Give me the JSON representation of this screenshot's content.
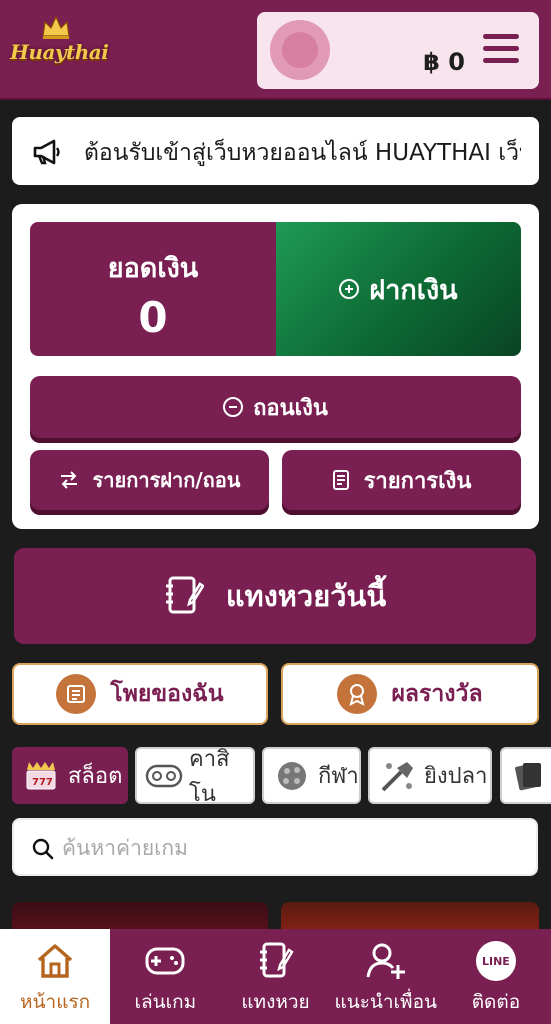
{
  "header": {
    "logo_text": "Huaythai",
    "balance_display": "฿ 0"
  },
  "announcement": {
    "text": "ีต้อนรับเข้าสู่เว็บหวยออนไลน์ HUAYTHAI เว็บ"
  },
  "wallet": {
    "balance_label": "ยอดเงิน",
    "balance_value": "0",
    "deposit_label": "ฝากเงิน",
    "withdraw_label": "ถอนเงิน",
    "history_label": "รายการฝาก/ถอน",
    "statement_label": "รายการเงิน"
  },
  "bet_today": {
    "label": "แทงหวยวันนี้"
  },
  "quick": {
    "my_tickets": "โพยของฉัน",
    "results": "ผลรางวัล"
  },
  "categories": [
    {
      "label": "สล็อต",
      "icon": "slot-machine-icon",
      "active": true
    },
    {
      "label": "คาสิโน",
      "icon": "casino-chips-icon",
      "active": false
    },
    {
      "label": "กีฬา",
      "icon": "sports-ball-icon",
      "active": false
    },
    {
      "label": "ยิงปลา",
      "icon": "fishing-gun-icon",
      "active": false
    },
    {
      "label": "",
      "icon": "cards-icon",
      "active": false
    }
  ],
  "search": {
    "placeholder": "ค้นหาค่ายเกม"
  },
  "bottom_nav": [
    {
      "label": "หน้าแรก",
      "icon": "home-icon",
      "active": true
    },
    {
      "label": "เล่นเกม",
      "icon": "gamepad-icon",
      "active": false
    },
    {
      "label": "แทงหวย",
      "icon": "notebook-pen-icon",
      "active": false
    },
    {
      "label": "แนะนำเพื่อน",
      "icon": "add-user-icon",
      "active": false
    },
    {
      "label": "ติดต่อ",
      "icon": "line-icon",
      "active": false
    }
  ],
  "line_badge": "LINE",
  "colors": {
    "brand": "#7a1f52",
    "deposit_green": "#0d6a34",
    "accent_gold": "#d9a45a"
  }
}
